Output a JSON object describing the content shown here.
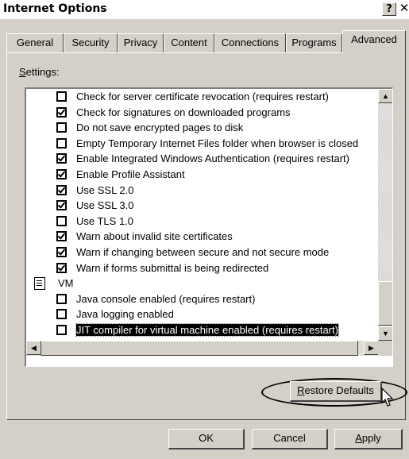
{
  "window": {
    "title": "Internet Options",
    "help_glyph": "?",
    "close_glyph": "✕"
  },
  "tabs": [
    {
      "label": "General"
    },
    {
      "label": "Security"
    },
    {
      "label": "Privacy"
    },
    {
      "label": "Content"
    },
    {
      "label": "Connections"
    },
    {
      "label": "Programs"
    },
    {
      "label": "Advanced",
      "active": true
    }
  ],
  "settings": {
    "label_prefix": "S",
    "label_rest": "ettings:",
    "items": [
      {
        "label": "Check for server certificate revocation (requires restart)",
        "checked": false
      },
      {
        "label": "Check for signatures on downloaded programs",
        "checked": true
      },
      {
        "label": "Do not save encrypted pages to disk",
        "checked": false
      },
      {
        "label": "Empty Temporary Internet Files folder when browser is closed",
        "checked": false
      },
      {
        "label": "Enable Integrated Windows Authentication (requires restart)",
        "checked": true
      },
      {
        "label": "Enable Profile Assistant",
        "checked": true
      },
      {
        "label": "Use SSL 2.0",
        "checked": true
      },
      {
        "label": "Use SSL 3.0",
        "checked": true
      },
      {
        "label": "Use TLS 1.0",
        "checked": false
      },
      {
        "label": "Warn about invalid site certificates",
        "checked": true
      },
      {
        "label": "Warn if changing between secure and not secure mode",
        "checked": true
      },
      {
        "label": "Warn if forms submittal is being redirected",
        "checked": true
      },
      {
        "label": "VM",
        "folder": true,
        "icon": "settings-folder-icon"
      },
      {
        "label": "Java console enabled (requires restart)",
        "checked": false
      },
      {
        "label": "Java logging enabled",
        "checked": false
      },
      {
        "label": "JIT compiler for virtual machine enabled (requires restart)",
        "checked": false,
        "selected": true
      }
    ]
  },
  "buttons": {
    "restore_prefix": "R",
    "restore_rest": "estore Defaults",
    "ok": "OK",
    "cancel": "Cancel",
    "apply_prefix": "A",
    "apply_rest": "pply"
  },
  "scroll_glyphs": {
    "up": "▲",
    "down": "▼",
    "left": "◀",
    "right": "▶"
  }
}
